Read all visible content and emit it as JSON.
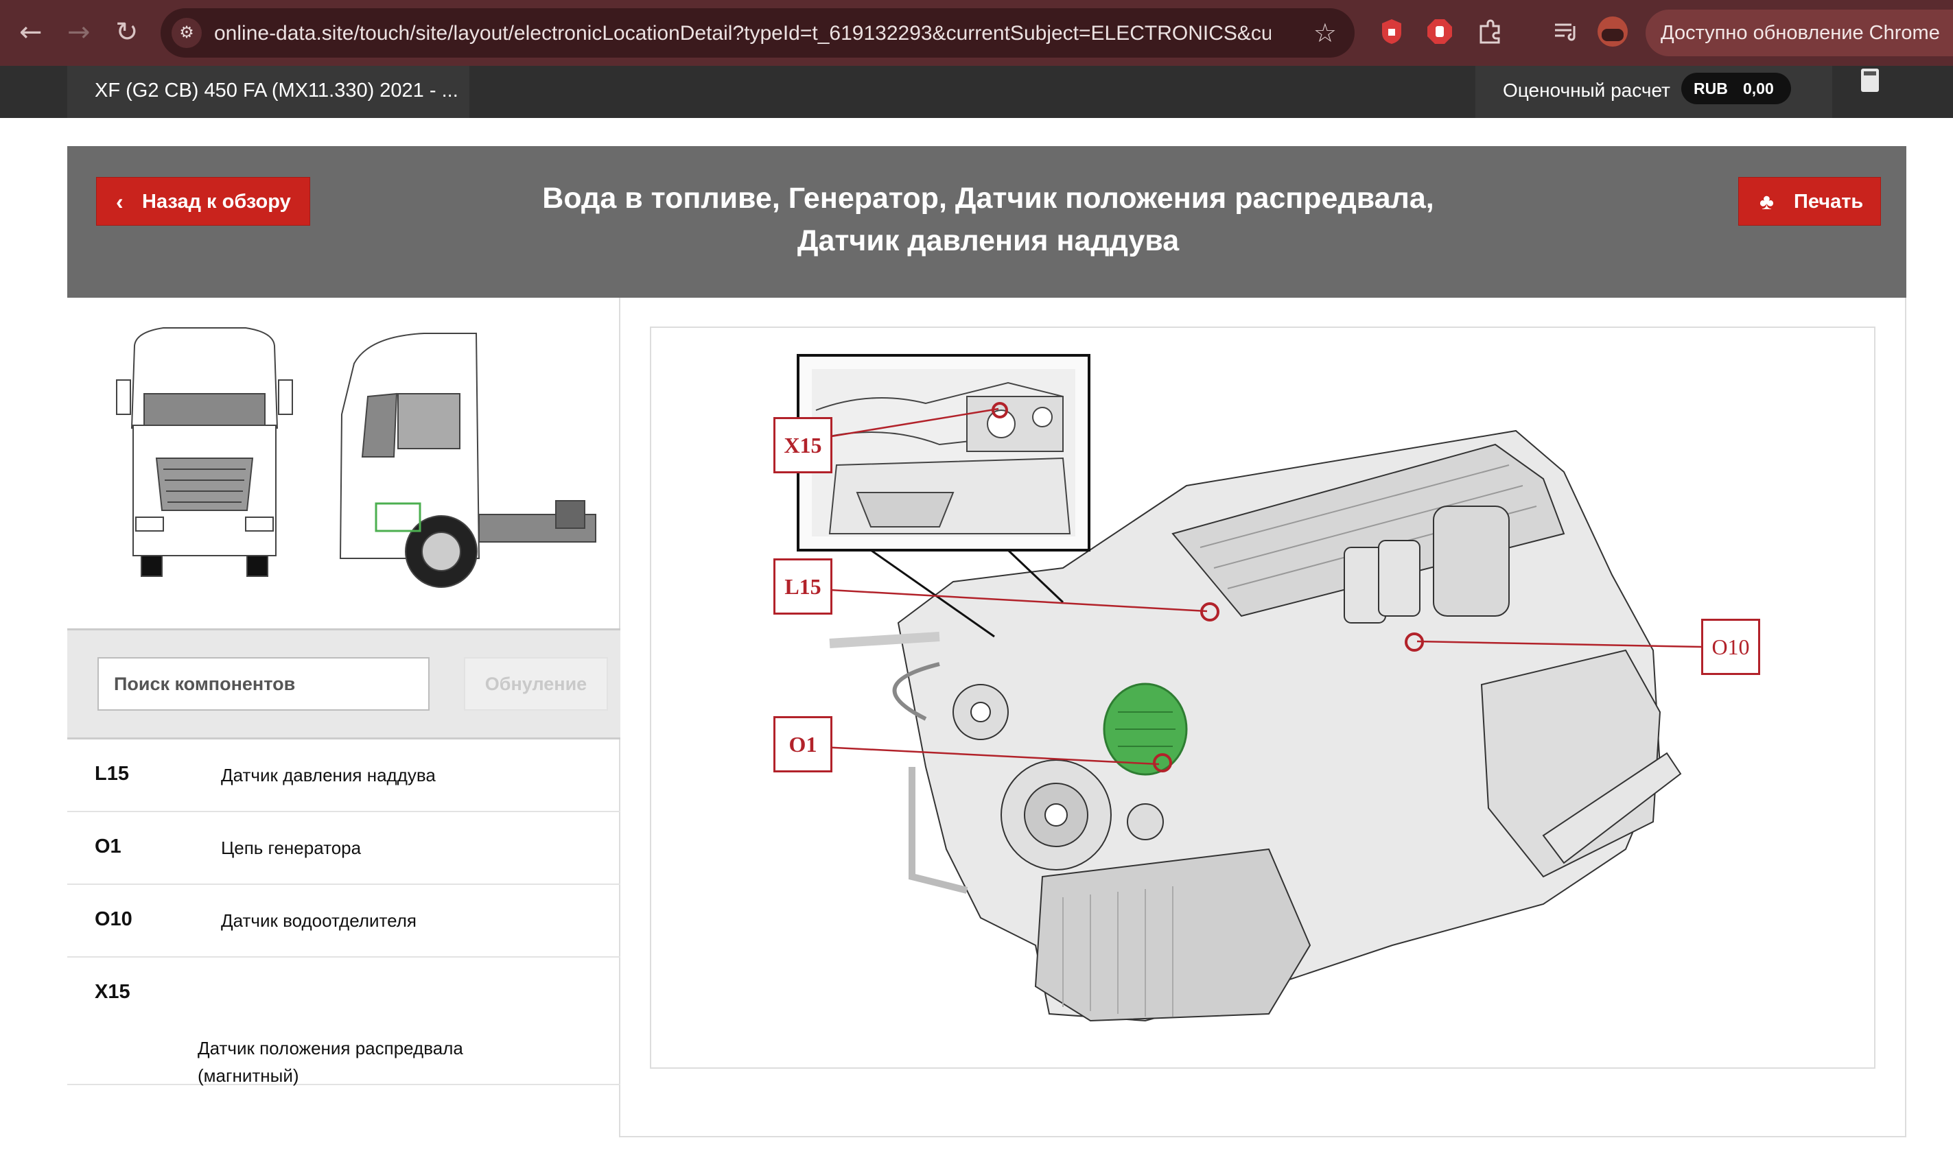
{
  "browser": {
    "back_icon": "←",
    "forward_icon": "→",
    "reload_icon": "↻",
    "url": "online-data.site/touch/site/layout/electronicLocationDetail?typeId=t_619132293&currentSubject=ELECTRONICS&cur...",
    "update_label": "Доступно обновление Chrome"
  },
  "topbar": {
    "vehicle": "XF (G2 CB) 450 FA (MX11.330) 2021 - ...",
    "estimate_label": "Оценочный расчет",
    "currency": "RUB",
    "amount": "0,00"
  },
  "header": {
    "back_label": "Назад к обзору",
    "title_line1": "Вода в топливе, Генератор, Датчик положения распредвала,",
    "title_line2": "Датчик давления наддува",
    "print_label": "Печать"
  },
  "search": {
    "placeholder": "Поиск компонентов",
    "reset_label": "Обнуление"
  },
  "components": [
    {
      "code": "L15",
      "name": "Датчик давления наддува"
    },
    {
      "code": "O1",
      "name": "Цепь генератора"
    },
    {
      "code": "O10",
      "name": "Датчик водоотделителя"
    },
    {
      "code": "X15",
      "name_line1": "Датчик положения распредвала",
      "name_line2": "(магнитный)"
    }
  ],
  "diagram_labels": {
    "x15": "X15",
    "l15": "L15",
    "o1": "O1",
    "o10": "O10"
  },
  "colors": {
    "accent_red": "#c9231d",
    "label_red": "#b2222a",
    "highlight_green": "#4caf50",
    "header_gray": "#6b6b6b"
  }
}
